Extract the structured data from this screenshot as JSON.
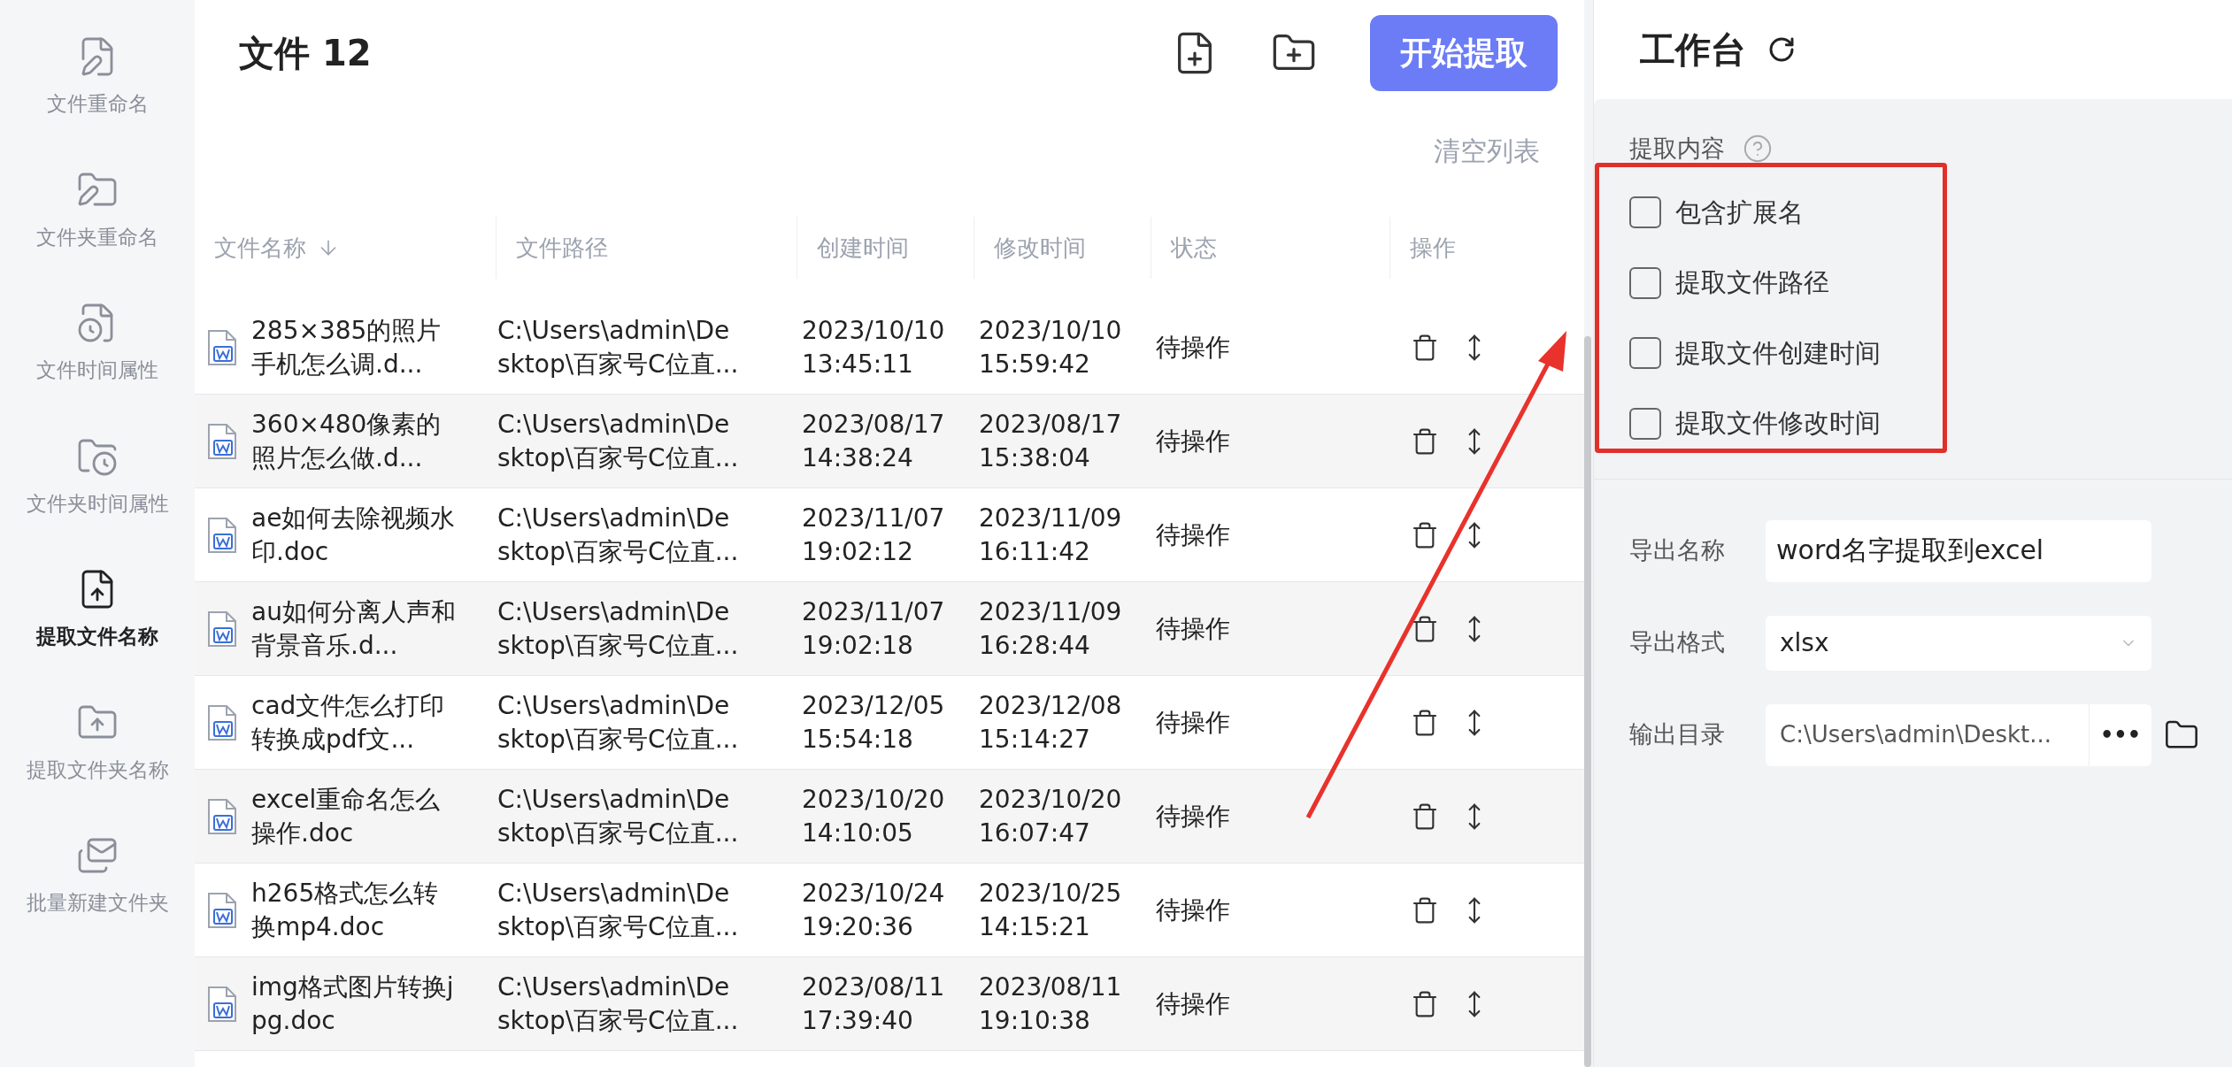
{
  "sidebar": {
    "items": [
      {
        "kind": "file-pen",
        "label": "文件重命名",
        "selected": false
      },
      {
        "kind": "folder-pen",
        "label": "文件夹重命名",
        "selected": false
      },
      {
        "kind": "file-clock",
        "label": "文件时间属性",
        "selected": false
      },
      {
        "kind": "folder-clock",
        "label": "文件夹时间属性",
        "selected": false
      },
      {
        "kind": "file-up",
        "label": "提取文件名称",
        "selected": true
      },
      {
        "kind": "folder-up",
        "label": "提取文件夹名称",
        "selected": false
      },
      {
        "kind": "mail",
        "label": "批量新建文件夹",
        "selected": false
      }
    ]
  },
  "file_list": {
    "title": "文件 12",
    "start_button": "开始提取",
    "clear_link": "清空列表",
    "columns": [
      "文件名称",
      "文件路径",
      "创建时间",
      "修改时间",
      "状态",
      "操作"
    ],
    "rows": [
      {
        "name": "285×385的照片手机怎么调.d...",
        "path": "C:\\Users\\admin\\De\nsktop\\百家号C位直...",
        "created": "2023/10/10\n13:45:11",
        "modified": "2023/10/10\n15:59:42",
        "status": "待操作"
      },
      {
        "name": "360×480像素的照片怎么做.d...",
        "path": "C:\\Users\\admin\\De\nsktop\\百家号C位直...",
        "created": "2023/08/17\n14:38:24",
        "modified": "2023/08/17\n15:38:04",
        "status": "待操作"
      },
      {
        "name": "ae如何去除视频水印.doc",
        "path": "C:\\Users\\admin\\De\nsktop\\百家号C位直...",
        "created": "2023/11/07\n19:02:12",
        "modified": "2023/11/09\n16:11:42",
        "status": "待操作"
      },
      {
        "name": "au如何分离人声和背景音乐.d...",
        "path": "C:\\Users\\admin\\De\nsktop\\百家号C位直...",
        "created": "2023/11/07\n19:02:18",
        "modified": "2023/11/09\n16:28:44",
        "status": "待操作"
      },
      {
        "name": "cad文件怎么打印转换成pdf文...",
        "path": "C:\\Users\\admin\\De\nsktop\\百家号C位直...",
        "created": "2023/12/05\n15:54:18",
        "modified": "2023/12/08\n15:14:27",
        "status": "待操作"
      },
      {
        "name": "excel重命名怎么操作.doc",
        "path": "C:\\Users\\admin\\De\nsktop\\百家号C位直...",
        "created": "2023/10/20\n14:10:05",
        "modified": "2023/10/20\n16:07:47",
        "status": "待操作"
      },
      {
        "name": "h265格式怎么转换mp4.doc",
        "path": "C:\\Users\\admin\\De\nsktop\\百家号C位直...",
        "created": "2023/10/24\n19:20:36",
        "modified": "2023/10/25\n14:15:21",
        "status": "待操作"
      },
      {
        "name": "img格式图片转换jpg.doc",
        "path": "C:\\Users\\admin\\De\nsktop\\百家号C位直...",
        "created": "2023/08/11\n17:39:40",
        "modified": "2023/08/11\n19:10:38",
        "status": "待操作"
      }
    ]
  },
  "workbench": {
    "title": "工作台",
    "section_label": "提取内容",
    "options": [
      {
        "label": "包含扩展名",
        "checked": false
      },
      {
        "label": "提取文件路径",
        "checked": false
      },
      {
        "label": "提取文件创建时间",
        "checked": false
      },
      {
        "label": "提取文件修改时间",
        "checked": false
      }
    ],
    "export_name": {
      "label": "导出名称",
      "value": "word名字提取到excel"
    },
    "export_format": {
      "label": "导出格式",
      "value": "xlsx"
    },
    "output_dir": {
      "label": "输出目录",
      "value": "C:\\Users\\admin\\Deskt...",
      "more": "•••"
    }
  }
}
